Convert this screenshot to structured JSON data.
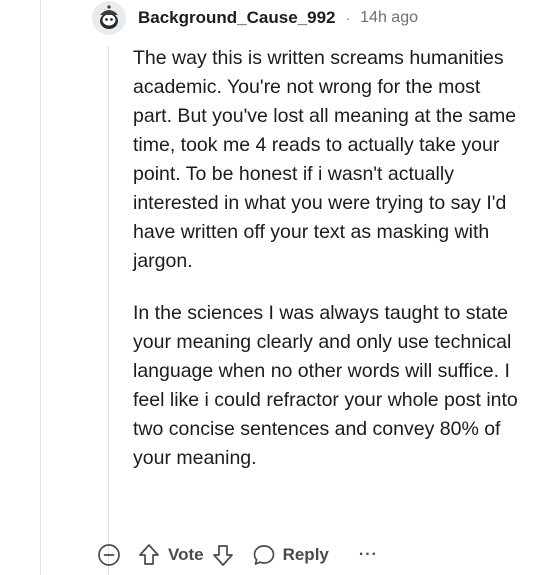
{
  "comment": {
    "author": "Background_Cause_992",
    "separator": "·",
    "time": "14h ago",
    "paragraphs": [
      "The way this is written screams humanities academic. You're not wrong for the most part. But you've lost all meaning at the same time, took me 4 reads to actually take your point. To be honest if i wasn't actually interested in what you were trying to say I'd have written off your text as masking with jargon.",
      "In the sciences I was always taught to state your meaning clearly and only use technical language when no other words will suffice. I feel like i could refractor your whole post into two concise sentences and convey 80% of your meaning."
    ]
  },
  "actions": {
    "vote_label": "Vote",
    "reply_label": "Reply",
    "more_label": "···"
  },
  "icons": {
    "collapse": "minus-circle-icon",
    "upvote": "arrow-up-icon",
    "downvote": "arrow-down-icon",
    "reply": "speech-bubble-icon",
    "more": "ellipsis-icon"
  },
  "colors": {
    "text": "#1c1c1c",
    "muted": "#6f6f6f",
    "thread_line": "#dfe3e6"
  }
}
